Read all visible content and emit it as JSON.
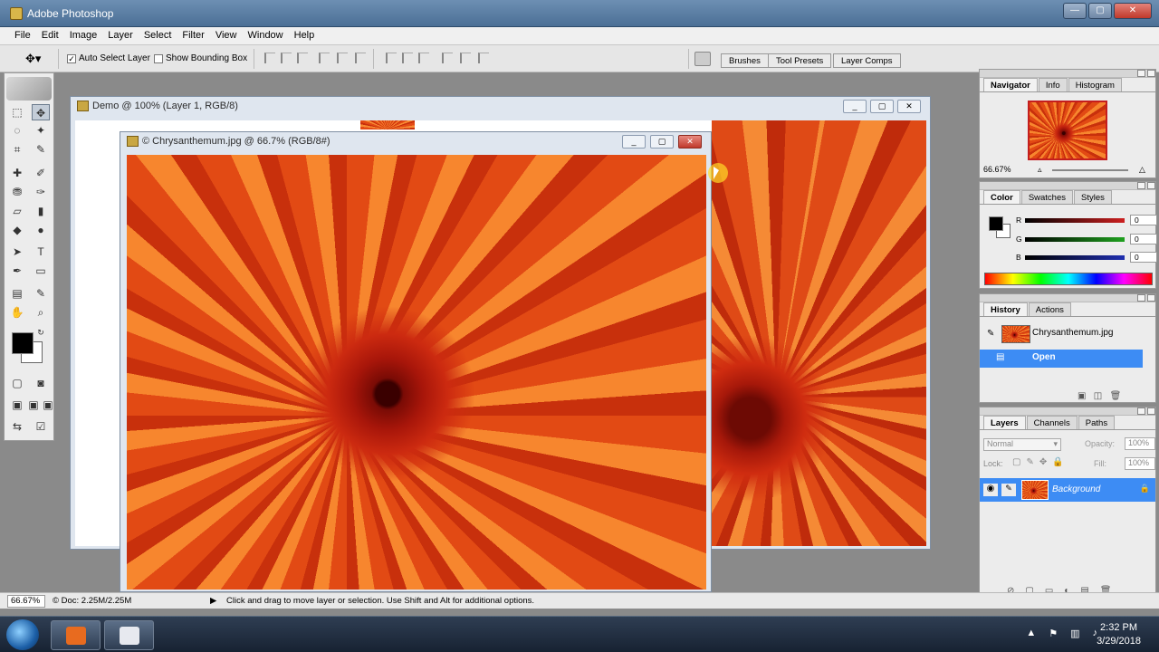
{
  "window": {
    "title": "Adobe Photoshop",
    "controls": [
      "minimize",
      "maximize",
      "close"
    ]
  },
  "menubar": [
    "File",
    "Edit",
    "Image",
    "Layer",
    "Select",
    "Filter",
    "View",
    "Window",
    "Help"
  ],
  "options": {
    "auto_select": "Auto Select Layer",
    "show_bounding": "Show Bounding Box"
  },
  "palette_well": {
    "tabs": [
      "Brushes",
      "Tool Presets",
      "Layer Comps"
    ]
  },
  "documents": [
    {
      "title": "Demo @ 100% (Layer 1, RGB/8)"
    },
    {
      "title": "© Chrysanthemum.jpg @ 66.7% (RGB/8#)"
    }
  ],
  "navigator": {
    "tabs": [
      "Navigator",
      "Info",
      "Histogram"
    ],
    "zoom": "66.67%"
  },
  "color": {
    "tabs": [
      "Color",
      "Swatches",
      "Styles"
    ],
    "channels": [
      {
        "label": "R",
        "value": "0",
        "color": "#cc1f1f"
      },
      {
        "label": "G",
        "value": "0",
        "color": "#1fa11f"
      },
      {
        "label": "B",
        "value": "0",
        "color": "#1f2fb0"
      }
    ]
  },
  "history": {
    "tabs": [
      "History",
      "Actions"
    ],
    "items": [
      {
        "label": "Chrysanthemum.jpg"
      },
      {
        "label": "Open"
      }
    ]
  },
  "layers": {
    "tabs": [
      "Layers",
      "Channels",
      "Paths"
    ],
    "blend_mode": "Normal",
    "opacity_label": "Opacity:",
    "opacity": "100%",
    "lock_label": "Lock:",
    "fill_label": "Fill:",
    "fill": "100%",
    "items": [
      {
        "label": "Background"
      }
    ]
  },
  "status": {
    "zoom": "66.67%",
    "doc": "© Doc: 2.25M/2.25M",
    "hint": "Click and drag to move layer or selection.  Use Shift and Alt for additional options."
  },
  "taskbar": {
    "time": "2:32 PM",
    "date": "3/29/2018"
  }
}
